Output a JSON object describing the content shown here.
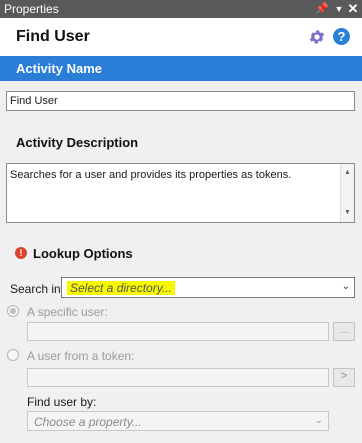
{
  "window": {
    "title": "Properties",
    "pin_glyph": "⮟",
    "close_glyph": "✕"
  },
  "header": {
    "title": "Find User",
    "settings_icon": "gear-icon",
    "help_icon": "help-icon",
    "help_glyph": "?"
  },
  "activity_name": {
    "section_label": "Activity Name",
    "value": "Find User"
  },
  "activity_description": {
    "label": "Activity Description",
    "value": "Searches for a user and provides its properties as tokens."
  },
  "lookup_options": {
    "label": "Lookup Options",
    "warning_glyph": "!",
    "search_in": {
      "label": "Search in:",
      "placeholder": "Select a directory..."
    },
    "specific_user": {
      "label": "A specific user:",
      "value": "",
      "browse_label": "..."
    },
    "token_user": {
      "label": "A user from a token:",
      "value": "",
      "button_label": ">"
    },
    "find_user_by": {
      "label": "Find user by:",
      "placeholder": "Choose a property..."
    }
  },
  "colors": {
    "accent": "#2b7ed7",
    "titlebar": "#595959",
    "highlight": "#f7f700",
    "warning": "#d9442e"
  }
}
